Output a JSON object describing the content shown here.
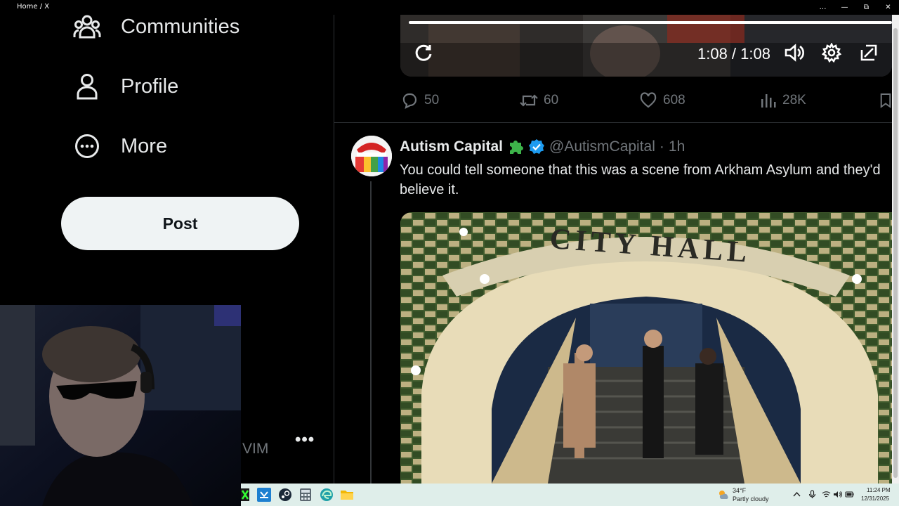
{
  "window": {
    "title": "Home / X",
    "controls": [
      "…",
      "—",
      "⧉",
      "✕"
    ]
  },
  "nav": {
    "items": [
      {
        "label": "Communities",
        "icon": "communities-icon"
      },
      {
        "label": "Profile",
        "icon": "profile-icon"
      },
      {
        "label": "More",
        "icon": "more-icon"
      }
    ],
    "post_label": "Post"
  },
  "account": {
    "handle_fragment": "VIM",
    "more_label": "•••"
  },
  "video": {
    "time": "1:08 / 1:08",
    "progress": 1.0
  },
  "actions": {
    "replies": "50",
    "reposts": "60",
    "likes": "608",
    "views": "28K"
  },
  "tweet": {
    "name": "Autism Capital",
    "handle": "@AutismCapital",
    "separator": "·",
    "time": "1h",
    "text": "You could tell someone that this was a scene from Arkham Asylum and they'd believe it.",
    "media_sign": "CITY HALL"
  },
  "taskbar": {
    "weather_temp": "34°F",
    "weather_desc": "Partly cloudy",
    "clock_time": "11:24 PM",
    "clock_date": "12/31/2025"
  },
  "colors": {
    "background": "#000000",
    "text": "#e7e9ea",
    "muted": "#71767b",
    "verified": "#1d9bf0",
    "post_button": "#eff3f4",
    "taskbar": "#dfeeea"
  }
}
